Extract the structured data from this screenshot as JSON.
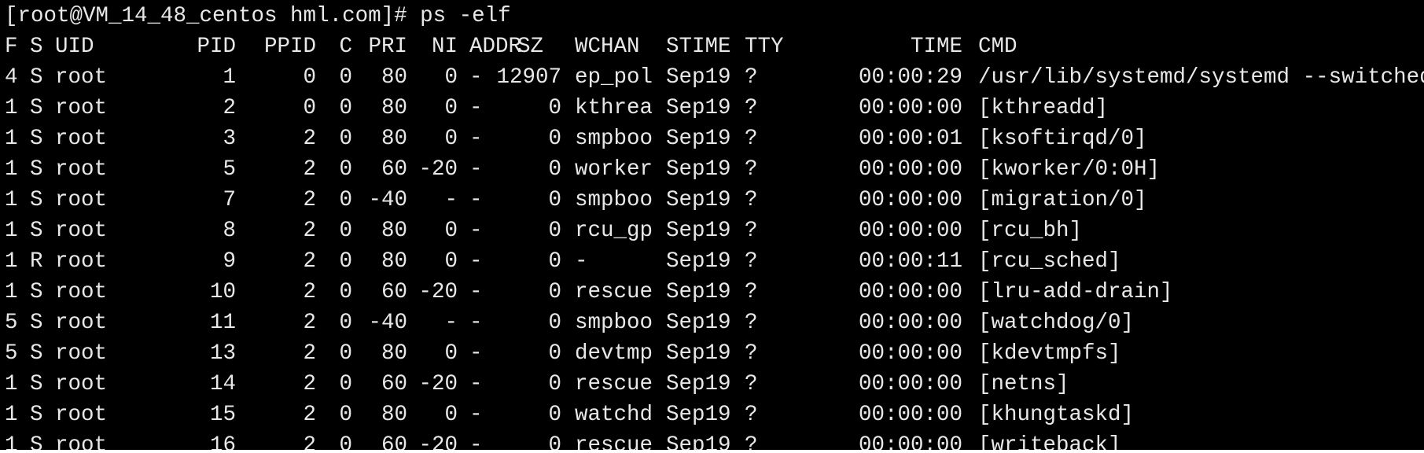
{
  "terminal": {
    "prompt_line": "[root@VM_14_48_centos hml.com]# ps -elf",
    "headers": [
      "F",
      "S",
      "UID",
      "PID",
      "PPID",
      "C",
      "PRI",
      "NI",
      "ADDR",
      "SZ",
      "WCHAN",
      "STIME",
      "TTY",
      "TIME",
      "CMD"
    ],
    "rows": [
      {
        "f": "4",
        "s": "S",
        "uid": "root",
        "pid": "1",
        "ppid": "0",
        "c": "0",
        "pri": "80",
        "ni": "0",
        "addr": "-",
        "sz": "12907",
        "wchan": "ep_pol",
        "stime": "Sep19",
        "tty": "?",
        "time": "00:00:29",
        "cmd": "/usr/lib/systemd/systemd --switched"
      },
      {
        "f": "1",
        "s": "S",
        "uid": "root",
        "pid": "2",
        "ppid": "0",
        "c": "0",
        "pri": "80",
        "ni": "0",
        "addr": "-",
        "sz": "0",
        "wchan": "kthrea",
        "stime": "Sep19",
        "tty": "?",
        "time": "00:00:00",
        "cmd": "[kthreadd]"
      },
      {
        "f": "1",
        "s": "S",
        "uid": "root",
        "pid": "3",
        "ppid": "2",
        "c": "0",
        "pri": "80",
        "ni": "0",
        "addr": "-",
        "sz": "0",
        "wchan": "smpboo",
        "stime": "Sep19",
        "tty": "?",
        "time": "00:00:01",
        "cmd": "[ksoftirqd/0]"
      },
      {
        "f": "1",
        "s": "S",
        "uid": "root",
        "pid": "5",
        "ppid": "2",
        "c": "0",
        "pri": "60",
        "ni": "-20",
        "addr": "-",
        "sz": "0",
        "wchan": "worker",
        "stime": "Sep19",
        "tty": "?",
        "time": "00:00:00",
        "cmd": "[kworker/0:0H]"
      },
      {
        "f": "1",
        "s": "S",
        "uid": "root",
        "pid": "7",
        "ppid": "2",
        "c": "0",
        "pri": "-40",
        "ni": "-",
        "addr": "-",
        "sz": "0",
        "wchan": "smpboo",
        "stime": "Sep19",
        "tty": "?",
        "time": "00:00:00",
        "cmd": "[migration/0]"
      },
      {
        "f": "1",
        "s": "S",
        "uid": "root",
        "pid": "8",
        "ppid": "2",
        "c": "0",
        "pri": "80",
        "ni": "0",
        "addr": "-",
        "sz": "0",
        "wchan": "rcu_gp",
        "stime": "Sep19",
        "tty": "?",
        "time": "00:00:00",
        "cmd": "[rcu_bh]"
      },
      {
        "f": "1",
        "s": "R",
        "uid": "root",
        "pid": "9",
        "ppid": "2",
        "c": "0",
        "pri": "80",
        "ni": "0",
        "addr": "-",
        "sz": "0",
        "wchan": "-",
        "stime": "Sep19",
        "tty": "?",
        "time": "00:00:11",
        "cmd": "[rcu_sched]"
      },
      {
        "f": "1",
        "s": "S",
        "uid": "root",
        "pid": "10",
        "ppid": "2",
        "c": "0",
        "pri": "60",
        "ni": "-20",
        "addr": "-",
        "sz": "0",
        "wchan": "rescue",
        "stime": "Sep19",
        "tty": "?",
        "time": "00:00:00",
        "cmd": "[lru-add-drain]"
      },
      {
        "f": "5",
        "s": "S",
        "uid": "root",
        "pid": "11",
        "ppid": "2",
        "c": "0",
        "pri": "-40",
        "ni": "-",
        "addr": "-",
        "sz": "0",
        "wchan": "smpboo",
        "stime": "Sep19",
        "tty": "?",
        "time": "00:00:00",
        "cmd": "[watchdog/0]"
      },
      {
        "f": "5",
        "s": "S",
        "uid": "root",
        "pid": "13",
        "ppid": "2",
        "c": "0",
        "pri": "80",
        "ni": "0",
        "addr": "-",
        "sz": "0",
        "wchan": "devtmp",
        "stime": "Sep19",
        "tty": "?",
        "time": "00:00:00",
        "cmd": "[kdevtmpfs]"
      },
      {
        "f": "1",
        "s": "S",
        "uid": "root",
        "pid": "14",
        "ppid": "2",
        "c": "0",
        "pri": "60",
        "ni": "-20",
        "addr": "-",
        "sz": "0",
        "wchan": "rescue",
        "stime": "Sep19",
        "tty": "?",
        "time": "00:00:00",
        "cmd": "[netns]"
      },
      {
        "f": "1",
        "s": "S",
        "uid": "root",
        "pid": "15",
        "ppid": "2",
        "c": "0",
        "pri": "80",
        "ni": "0",
        "addr": "-",
        "sz": "0",
        "wchan": "watchd",
        "stime": "Sep19",
        "tty": "?",
        "time": "00:00:00",
        "cmd": "[khungtaskd]"
      },
      {
        "f": "1",
        "s": "S",
        "uid": "root",
        "pid": "16",
        "ppid": "2",
        "c": "0",
        "pri": "60",
        "ni": "-20",
        "addr": "-",
        "sz": "0",
        "wchan": "rescue",
        "stime": "Sep19",
        "tty": "?",
        "time": "00:00:00",
        "cmd": "[writeback]"
      }
    ]
  },
  "colors": {
    "background": "#000000",
    "foreground": "#e8e8e8"
  }
}
